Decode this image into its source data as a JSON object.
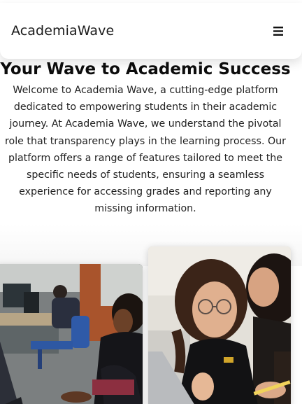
{
  "navbar": {
    "brand": "AcademiaWave",
    "menu_icon": "hamburger-menu-icon"
  },
  "hero": {
    "title": "Your Wave to Academic Success",
    "description": "Welcome to Academia Wave, a cutting-edge platform dedicated to empowering students in their academic journey. At Academia Wave, we understand the pivotal role that transparency plays in the learning process. Our platform offers a range of features tailored to meet the specific needs of students, ensuring a seamless experience for accessing grades and reporting any missing information."
  },
  "images": [
    {
      "name": "students-studying-photo"
    },
    {
      "name": "students-laptop-photo"
    }
  ]
}
